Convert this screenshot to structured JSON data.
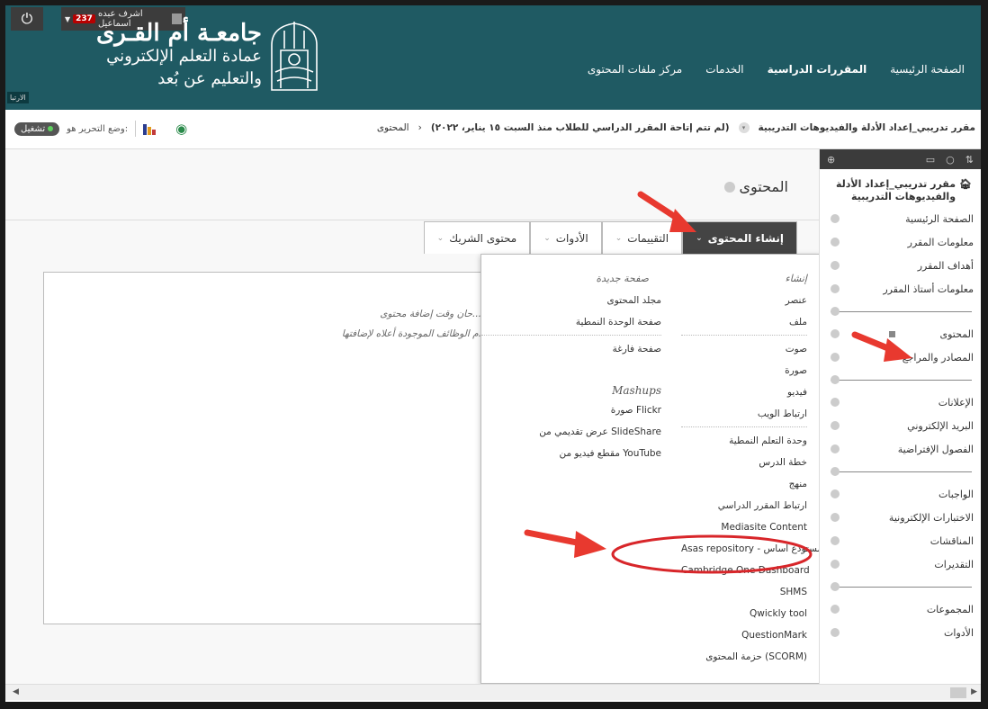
{
  "header": {
    "power_icon": "power-icon",
    "user_name": "اشرف عبده اسماعيل",
    "notification_count": "237",
    "uni_title": "جامعـة أم القـرى",
    "uni_sub1": "عمادة التعلم الإلكتروني",
    "uni_sub2": "والتعليم عن بُعد",
    "tiny_label": "الارتبا",
    "nav": [
      {
        "label": "الصفحة الرئيسية",
        "active": false
      },
      {
        "label": "المقررات الدراسية",
        "active": true
      },
      {
        "label": "الخدمات",
        "active": false
      },
      {
        "label": "مركز ملفات المحتوى",
        "active": false
      }
    ]
  },
  "breadcrumb": {
    "course": "مقرر تدريبي_إعداد الأدلة والفيديوهات التدريبية",
    "availability": "(لم تتم إتاحة المقرر الدراسي للطلاب منذ السبت ١٥ يناير، ٢٠٢٢)",
    "current": "المحتوى",
    "edit_mode_label": "وضع التحرير هو:",
    "edit_mode_value": "تشغيل"
  },
  "sidebar": {
    "course_title": "مقرر تدريبي_إعداد الأدلة والفيديوهات التدريبية",
    "groups": [
      [
        "الصفحة الرئيسية",
        "معلومات المقرر",
        "أهداف المقرر",
        "معلومات أستاذ المقرر"
      ],
      [
        "المحتوى",
        "المصادر والمراجع"
      ],
      [
        "الإعلانات",
        "البريد الإلكتروني",
        "الفصول الإفتراضية"
      ],
      [
        "الواجبات",
        "الاختبارات الإلكترونية",
        "المناقشات",
        "التقديرات"
      ],
      [
        "المجموعات",
        "الأدوات"
      ]
    ]
  },
  "main": {
    "page_title": "المحتوى",
    "tabs": [
      "إنشاء المحتوى",
      "التقييمات",
      "الأدوات",
      "محتوى الشريك"
    ],
    "empty_line1": "حان وقت إضافة محتوى...",
    "empty_line2": "م الوظائف الموجودة أعلاه لإضافتها."
  },
  "menu": {
    "create_heading": "إنشاء",
    "create_items": [
      "عنصر",
      "ملف",
      "صوت",
      "صورة",
      "فيديو",
      "ارتباط الويب",
      "وحدة التعلم النمطية",
      "خطة الدرس",
      "منهج",
      "ارتباط المقرر الدراسي",
      "Mediasite Content",
      "Asas repository - مستودع أساس",
      "Cambridge One Dashboard",
      "SHMS",
      "Qwickly tool",
      "QuestionMark",
      "حزمة المحتوى (SCORM)"
    ],
    "new_page_heading": "صفحة جديدة",
    "new_page_items": [
      "مجلد المحتوى",
      "صفحة الوحدة النمطية",
      "صفحة فارغة"
    ],
    "mashups_heading": "Mashups",
    "mashups_items": [
      "صورة Flickr",
      "عرض تقديمي من SlideShare",
      "مقطع فيديو من YouTube"
    ]
  },
  "colors": {
    "header_bg": "#1f5a63",
    "arrow": "#e8392f"
  }
}
